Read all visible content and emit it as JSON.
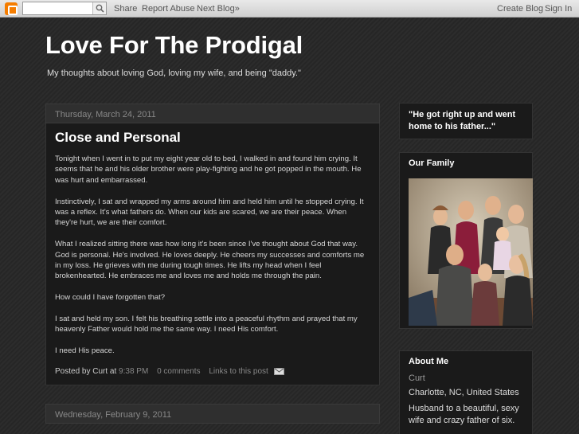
{
  "navbar": {
    "search_placeholder": "",
    "share": "Share",
    "report_abuse": "Report Abuse",
    "next_blog": "Next Blog»",
    "create_blog": "Create Blog",
    "sign_in": "Sign In"
  },
  "header": {
    "title": "Love For The Prodigal",
    "description": "My thoughts about loving God, loving my wife, and being \"daddy.\""
  },
  "post": {
    "date": "Thursday, March 24, 2011",
    "title": "Close and Personal",
    "paragraphs": [
      "Tonight when I went in to put my eight year old to bed, I walked in and found him crying.  It seems that he and his older brother were play-fighting and he got popped in the mouth.  He was hurt and embarrassed.",
      "Instinctively, I sat and wrapped my arms around him and held him until he stopped crying.  It was a reflex.  It's what fathers do.  When our kids are scared, we are their peace.  When they're hurt, we are their comfort.",
      "What I realized sitting there was how long it's been since I've thought about God that way.  God is personal.  He's involved.  He loves deeply.  He cheers my successes and comforts me in my loss.  He grieves with me during tough times.  He lifts my head when I feel brokenhearted.  He embraces me and loves me and holds me through the pain.",
      "How could I have forgotten that?",
      "I sat and held my son.  I felt his breathing settle into a peaceful rhythm and prayed that my heavenly Father would hold me the same way.  I need His comfort.",
      "I need His peace."
    ],
    "posted_by": "Posted by Curt at ",
    "time": "9:38 PM",
    "comments": "0 comments",
    "links": "Links to this post"
  },
  "next_post": {
    "date": "Wednesday, February 9, 2011"
  },
  "sidebar": {
    "quote": "\"He got right up and went home to his father...\"",
    "family_title": "Our Family",
    "about_title": "About Me",
    "about_name": "Curt",
    "about_location": "Charlotte, NC, United States",
    "about_text": "Husband to a beautiful, sexy wife and crazy father of six."
  },
  "colors": {
    "background": "#2a2a2a",
    "panel": "#1a1a1a",
    "blogger_orange": "#f57d00"
  }
}
